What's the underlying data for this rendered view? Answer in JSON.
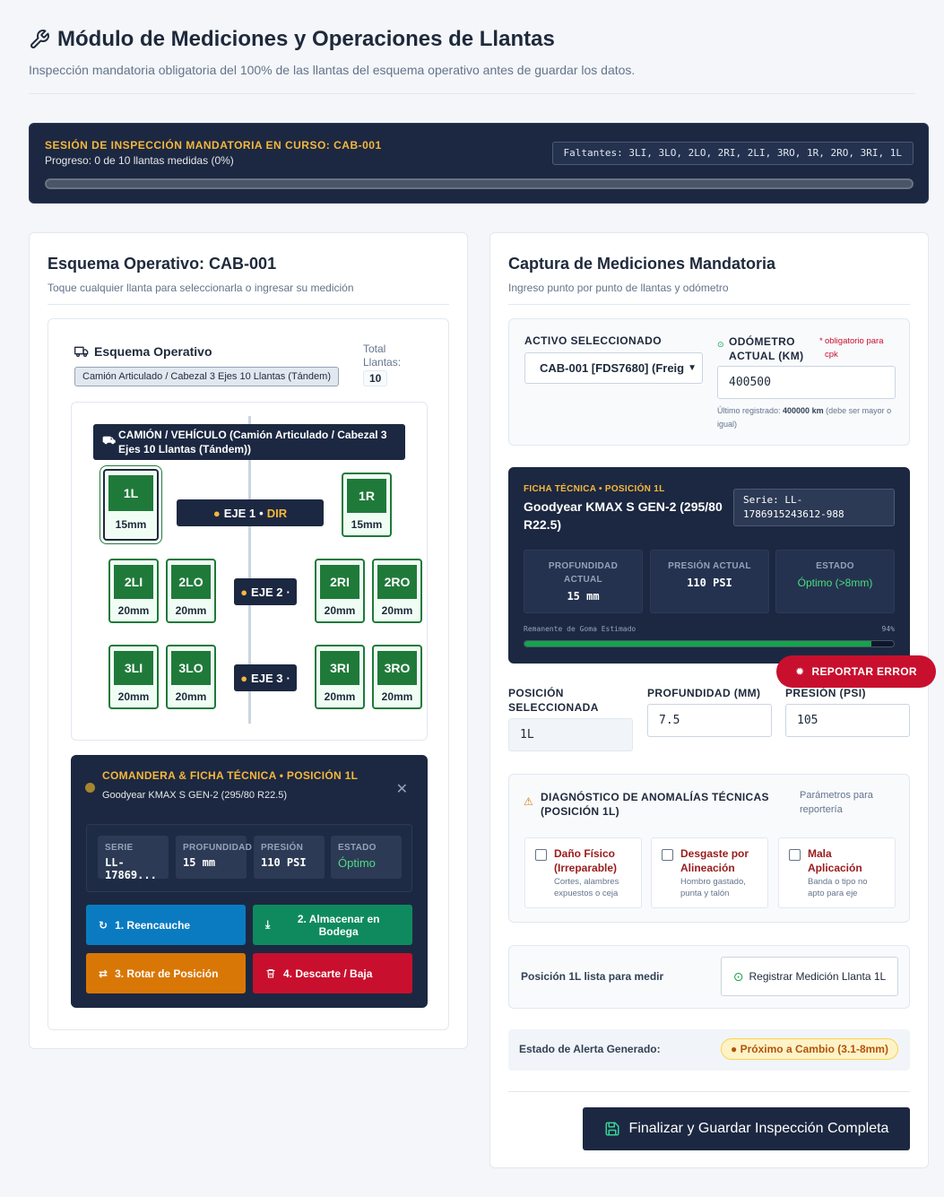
{
  "header": {
    "title": "Módulo de Mediciones y Operaciones de Llantas",
    "subtitle": "Inspección mandatoria obligatoria del 100% de las llantas del esquema operativo antes de guardar los datos."
  },
  "session": {
    "title": "SESIÓN DE INSPECCIÓN MANDATORIA EN CURSO: CAB-001",
    "progress": "Progreso: 0 de 10 llantas medidas (0%)",
    "progress_fraction": 0,
    "missing": "Faltantes: 3LI, 3LO, 2LO, 2RI, 2LI, 3RO, 1R, 2RO, 3RI, 1L"
  },
  "left": {
    "title": "Esquema Operativo: CAB-001",
    "subtitle": "Toque cualquier llanta para seleccionarla o ingresar su medición",
    "scheme_label": "Esquema Operativo",
    "scheme_type": "Camión Articulado / Cabezal 3 Ejes 10 Llantas (Tándem)",
    "total_label": "Total Llantas:",
    "total_value": "10",
    "vehicle_banner": "CAMIÓN / VEHÍCULO (Camión Articulado / Cabezal 3 Ejes 10 Llantas (Tándem))",
    "axles": [
      {
        "label": "EJE 1",
        "dir": "DIR"
      },
      {
        "label": "EJE 2"
      },
      {
        "label": "EJE 3"
      }
    ],
    "tires": {
      "t1L": {
        "pos": "1L",
        "mm": "15mm"
      },
      "t1R": {
        "pos": "1R",
        "mm": "15mm"
      },
      "t2LI": {
        "pos": "2LI",
        "mm": "20mm"
      },
      "t2LO": {
        "pos": "2LO",
        "mm": "20mm"
      },
      "t2RI": {
        "pos": "2RI",
        "mm": "20mm"
      },
      "t2RO": {
        "pos": "2RO",
        "mm": "20mm"
      },
      "t3LI": {
        "pos": "3LI",
        "mm": "20mm"
      },
      "t3LO": {
        "pos": "3LO",
        "mm": "20mm"
      },
      "t3RI": {
        "pos": "3RI",
        "mm": "20mm"
      },
      "t3RO": {
        "pos": "3RO",
        "mm": "20mm"
      }
    },
    "comandera": {
      "title": "COMANDERA & FICHA TÉCNICA • POSICIÓN 1L",
      "subtitle": "Goodyear KMAX S GEN-2 (295/80 R22.5)",
      "stats": [
        {
          "k": "SERIE",
          "v": "LL-17869..."
        },
        {
          "k": "PROFUNDIDAD",
          "v": "15 mm"
        },
        {
          "k": "PRESIÓN",
          "v": "110 PSI"
        },
        {
          "k": "ESTADO",
          "v": "Óptimo"
        }
      ],
      "actions": [
        {
          "label": "1. Reencauche",
          "color": "#0b7bc1"
        },
        {
          "label": "2. Almacenar en Bodega",
          "color": "#0f8a5f"
        },
        {
          "label": "3. Rotar de Posición",
          "color": "#d97706"
        },
        {
          "label": "4. Descarte / Baja",
          "color": "#c8102e"
        }
      ]
    }
  },
  "right": {
    "title": "Captura de Mediciones Mandatoria",
    "subtitle": "Ingreso punto por punto de llantas y odómetro",
    "activo_label": "ACTIVO SELECCIONADO",
    "activo_value": "CAB-001 [FDS7680] (Freig",
    "odometro_label": "ODÓMETRO ACTUAL (KM)",
    "odometro_required": "obligatorio para cpk",
    "odometro_value": "400500",
    "odometro_note_prefix": "Último registrado: ",
    "odometro_note_value": "400000 km",
    "odometro_note_suffix": " (debe ser mayor o igual)",
    "ficha": {
      "label": "FICHA TÉCNICA • POSICIÓN 1L",
      "title": "Goodyear KMAX S GEN-2 (295/80 R22.5)",
      "serie": "Serie: LL-1786915243612-988",
      "stats": [
        {
          "k": "PROFUNDIDAD ACTUAL",
          "v": "15 mm"
        },
        {
          "k": "PRESIÓN ACTUAL",
          "v": "110 PSI"
        },
        {
          "k": "ESTADO",
          "v": "Óptimo (>8mm)"
        }
      ],
      "remanente_label": "Remanente de Goma Estimado",
      "remanente_pct": "94%",
      "remanente_fraction": 0.94
    },
    "report_label": "REPORTAR ERROR",
    "posicion_label": "POSICIÓN SELECCIONADA",
    "posicion_value": "1L",
    "profundidad_label": "PROFUNDIDAD (MM)",
    "profundidad_value": "7.5",
    "presion_label": "PRESIÓN (PSI)",
    "presion_value": "105",
    "diag": {
      "title": "DIAGNÓSTICO DE ANOMALÍAS TÉCNICAS (POSICIÓN 1L)",
      "param": "Parámetros para reportería",
      "options": [
        {
          "t": "Daño Físico (Irreparable)",
          "d": "Cortes, alambres expuestos o ceja"
        },
        {
          "t": "Desgaste por Alineación",
          "d": "Hombro gastado, punta y talón"
        },
        {
          "t": "Mala Aplicación",
          "d": "Banda o tipo no apto para eje"
        }
      ]
    },
    "ready_text": "Posición 1L lista para medir",
    "register_label": "Registrar Medición Llanta 1L",
    "alert_label": "Estado de Alerta Generado:",
    "alert_badge": "Próximo a Cambio (3.1-8mm)",
    "final_label": "Finalizar y Guardar Inspección Completa"
  }
}
